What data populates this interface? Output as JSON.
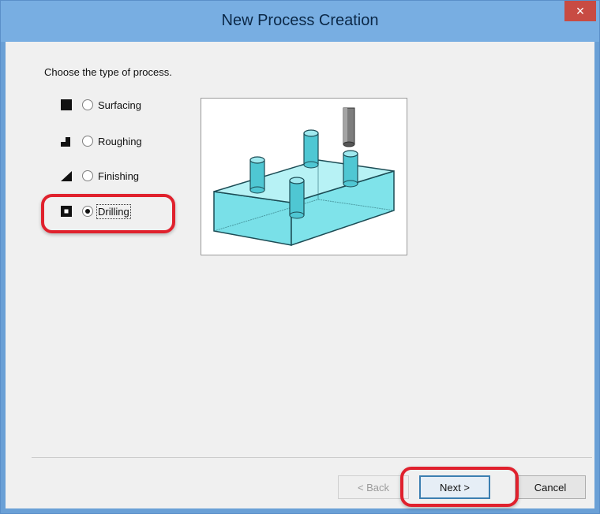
{
  "window": {
    "title": "New Process Creation",
    "close_glyph": "×"
  },
  "prompt": "Choose the type of process.",
  "options": [
    {
      "label": "Surfacing",
      "icon": "square-filled-icon",
      "checked": false
    },
    {
      "label": "Roughing",
      "icon": "step-icon",
      "checked": false
    },
    {
      "label": "Finishing",
      "icon": "wedge-icon",
      "checked": false
    },
    {
      "label": "Drilling",
      "icon": "square-hole-icon",
      "checked": true
    }
  ],
  "preview": {
    "subject": "drilling-preview"
  },
  "buttons": {
    "back": "< Back",
    "next": "Next >",
    "cancel": "Cancel"
  },
  "colors": {
    "titlebar": "#78aee2",
    "close": "#c84b43",
    "highlight": "#e0212d",
    "preview_fill": "#7fe3ea"
  }
}
